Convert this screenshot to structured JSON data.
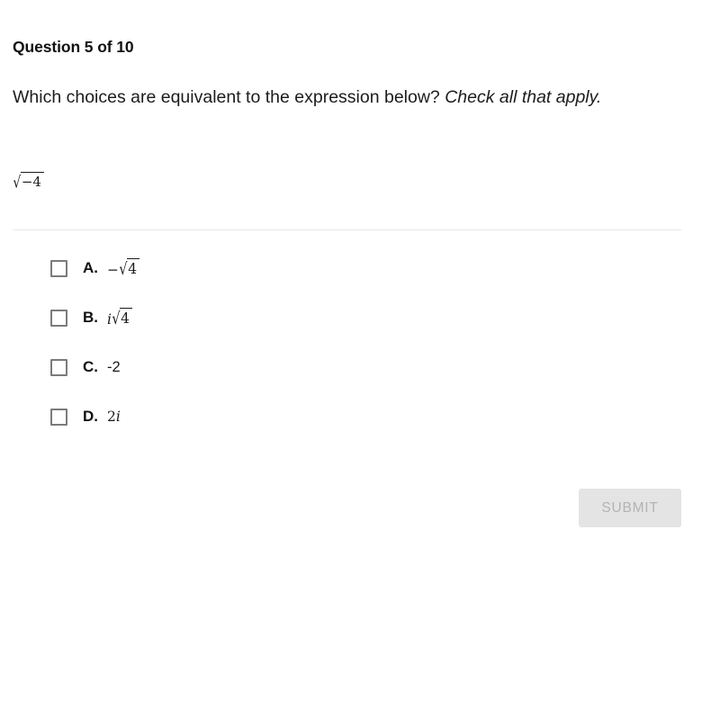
{
  "question": {
    "header": "Question 5 of 10",
    "prompt_main": "Which choices are equivalent to the expression below?",
    "prompt_emphasis": "Check all that apply.",
    "expression": {
      "radical_sign": "√",
      "radicand": "−4",
      "plain_text": "√−4"
    }
  },
  "choices": [
    {
      "letter": "A.",
      "type": "radical",
      "prefix": "−",
      "radical_sign": "√",
      "radicand": "4",
      "suffix": "",
      "plain_text": "−√4"
    },
    {
      "letter": "B.",
      "type": "radical",
      "prefix": "i",
      "prefix_italic": true,
      "radical_sign": "√",
      "radicand": "4",
      "suffix": "",
      "plain_text": "i√4"
    },
    {
      "letter": "C.",
      "type": "plain",
      "plain_text": "-2"
    },
    {
      "letter": "D.",
      "type": "plain_italic_suffix",
      "prefix": "2",
      "suffix": "i",
      "plain_text": "2i"
    }
  ],
  "submit": {
    "label": "SUBMIT",
    "enabled": false,
    "background_color": "#e4e4e4",
    "text_color": "#b3b3b3"
  },
  "colors": {
    "page_background": "#ffffff",
    "text": "#1a1a1a",
    "divider": "#e8e8e8",
    "checkbox_border": "#7b7b7b"
  }
}
